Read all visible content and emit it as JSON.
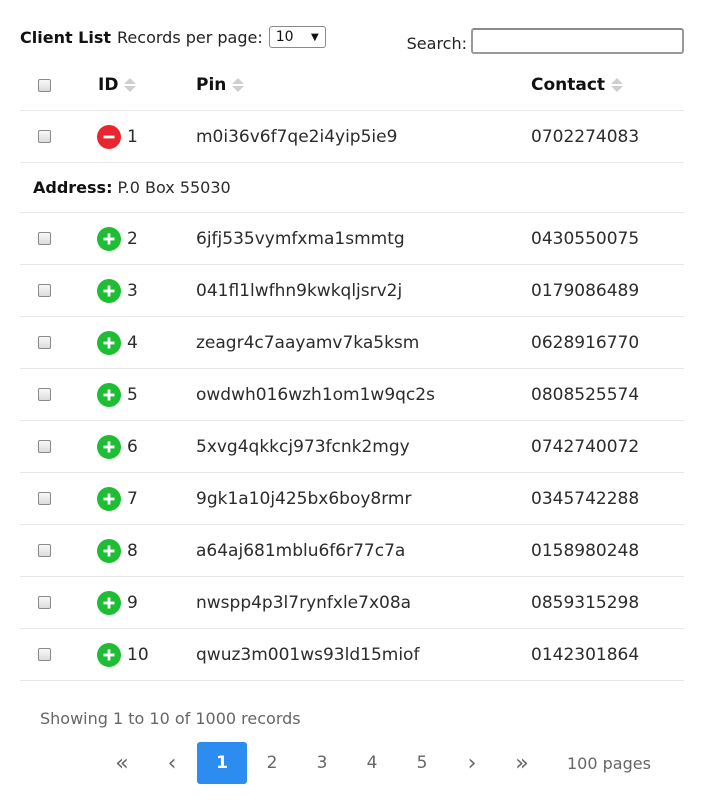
{
  "header": {
    "title": "Client List",
    "records_per_page_label": "Records per page:",
    "records_per_page_value": "10",
    "search_label": "Search:",
    "search_value": ""
  },
  "table": {
    "columns": [
      "ID",
      "Pin",
      "Contact"
    ],
    "rows": [
      {
        "id": "1",
        "pin": "m0i36v6f7qe2i4yip5ie9",
        "contact": "0702274083",
        "expanded": true
      },
      {
        "id": "2",
        "pin": "6jfj535vymfxma1smmtg",
        "contact": "0430550075",
        "expanded": false
      },
      {
        "id": "3",
        "pin": "041fl1lwfhn9kwkqljsrv2j",
        "contact": "0179086489",
        "expanded": false
      },
      {
        "id": "4",
        "pin": "zeagr4c7aayamv7ka5ksm",
        "contact": "0628916770",
        "expanded": false
      },
      {
        "id": "5",
        "pin": "owdwh016wzh1om1w9qc2s",
        "contact": "0808525574",
        "expanded": false
      },
      {
        "id": "6",
        "pin": "5xvg4qkkcj973fcnk2mgy",
        "contact": "0742740072",
        "expanded": false
      },
      {
        "id": "7",
        "pin": "9gk1a10j425bx6boy8rmr",
        "contact": "0345742288",
        "expanded": false
      },
      {
        "id": "8",
        "pin": "a64aj681mblu6f6r77c7a",
        "contact": "0158980248",
        "expanded": false
      },
      {
        "id": "9",
        "pin": "nwspp4p3l7rynfxle7x08a",
        "contact": "0859315298",
        "expanded": false
      },
      {
        "id": "10",
        "pin": "qwuz3m001ws93ld15miof",
        "contact": "0142301864",
        "expanded": false
      }
    ],
    "detail": {
      "label": "Address:",
      "value": "P.0 Box 55030"
    }
  },
  "footer": {
    "info": "Showing 1 to 10 of 1000 records",
    "first": "«",
    "prev": "‹",
    "pages": [
      "1",
      "2",
      "3",
      "4",
      "5"
    ],
    "active_page": "1",
    "next": "›",
    "last": "»",
    "pages_count": "100 pages"
  },
  "colors": {
    "collapse_icon": "#e8262f",
    "expand_icon": "#1ebd34",
    "active_page_bg": "#2d8cf0"
  },
  "icons": {
    "expanded_toggle": "minus-circle-icon",
    "collapsed_toggle": "plus-circle-icon",
    "sort": "sort-icon"
  }
}
